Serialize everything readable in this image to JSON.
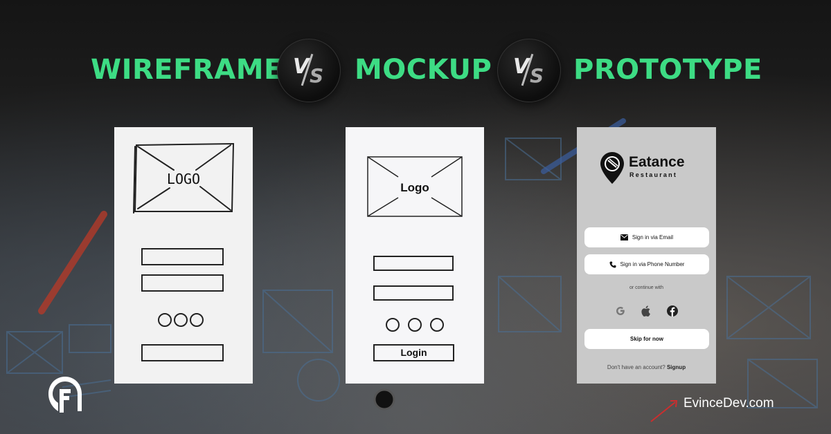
{
  "header": {
    "left_word": "WIREFRAME",
    "middle_word": "MOCKUP",
    "right_word": "PROTOTYPE",
    "vs_first": "V",
    "vs_second": "S"
  },
  "wireframe": {
    "logo_text": "LOGO"
  },
  "mockup": {
    "logo_text": "Logo",
    "login_label": "Login"
  },
  "prototype": {
    "brand_name": "Eatance",
    "brand_sub": "Restaurant",
    "email_button": "Sign in via Email",
    "phone_button": "Sign in via Phone Number",
    "or_text": "or continue with",
    "skip_button": "Skip for now",
    "footer_prompt": "Don't have an account?",
    "footer_link": "Signup",
    "social_icons": [
      "google-icon",
      "apple-icon",
      "facebook-icon"
    ]
  },
  "footer": {
    "url": "EvinceDev.com"
  },
  "colors": {
    "accent_green": "#3ddc84",
    "background": "#1c1c1c"
  }
}
